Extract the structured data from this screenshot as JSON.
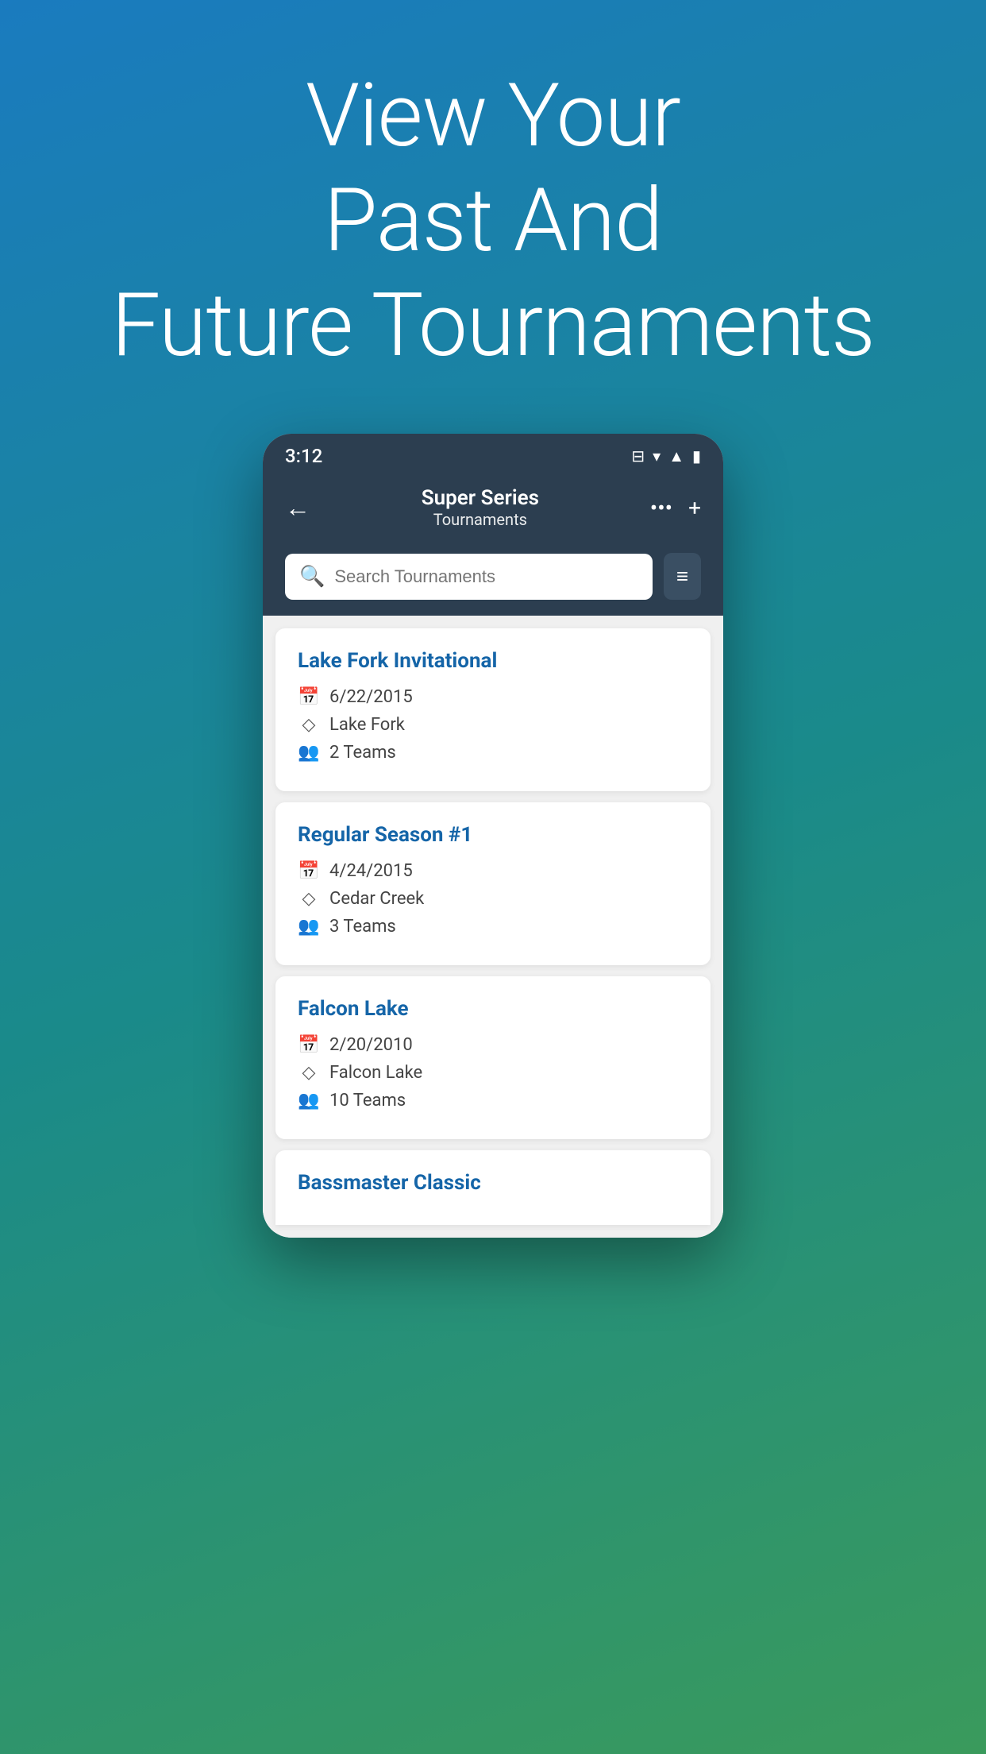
{
  "hero": {
    "line1": "View Your",
    "line2": "Past And",
    "line3": "Future Tournaments"
  },
  "status_bar": {
    "time": "3:12",
    "vibrate_icon": "📳",
    "wifi_icon": "▼",
    "signal_icon": "▲",
    "battery_icon": "🔋"
  },
  "header": {
    "title": "Super Series",
    "subtitle": "Tournaments",
    "back_label": "←",
    "more_label": "•••",
    "add_label": "+"
  },
  "search": {
    "placeholder": "Search Tournaments",
    "filter_label": "⚙"
  },
  "tournaments": [
    {
      "name": "Lake Fork Invitational",
      "date": "6/22/2015",
      "location": "Lake Fork",
      "teams": "2 Teams"
    },
    {
      "name": "Regular Season #1",
      "date": "4/24/2015",
      "location": "Cedar Creek",
      "teams": "3 Teams"
    },
    {
      "name": "Falcon Lake",
      "date": "2/20/2010",
      "location": "Falcon Lake",
      "teams": "10 Teams"
    },
    {
      "name": "Bassmaster Classic",
      "date": "",
      "location": "",
      "teams": ""
    }
  ],
  "colors": {
    "header_bg": "#2c3e50",
    "tournament_name": "#1565a8",
    "background_gradient_start": "#1a7bbf",
    "background_gradient_mid": "#1a8a8a",
    "background_gradient_end": "#3a9a5c"
  }
}
